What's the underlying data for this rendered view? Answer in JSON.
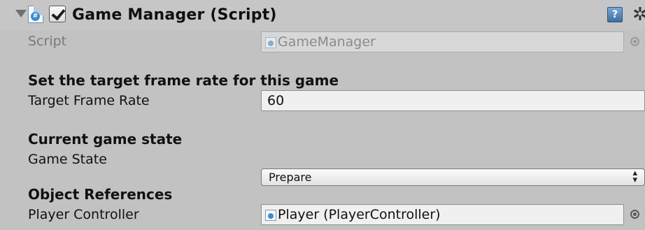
{
  "component": {
    "title": "Game Manager (Script)",
    "enabled": true,
    "icons": {
      "foldout": "foldout-arrow-icon",
      "script": "csharp-script-icon",
      "help": "help-book-icon",
      "settings": "gear-icon"
    },
    "help_glyph": "?",
    "settings_glyph": "✲"
  },
  "fields": {
    "script": {
      "label": "Script",
      "value": "GameManager"
    },
    "target_frame_rate": {
      "heading": "Set the target frame rate for this game",
      "label": "Target Frame Rate",
      "value": "60"
    },
    "game_state": {
      "heading": "Current game state",
      "label": "Game State",
      "value": "Prepare"
    },
    "player_controller": {
      "heading": "Object References",
      "label": "Player Controller",
      "value": "Player (PlayerController)"
    }
  },
  "colors": {
    "background": "#c2c2c2",
    "field_bg": "#f0f0f0",
    "disabled_text": "#7a7a7a",
    "accent_blue": "#3c8ccf"
  }
}
